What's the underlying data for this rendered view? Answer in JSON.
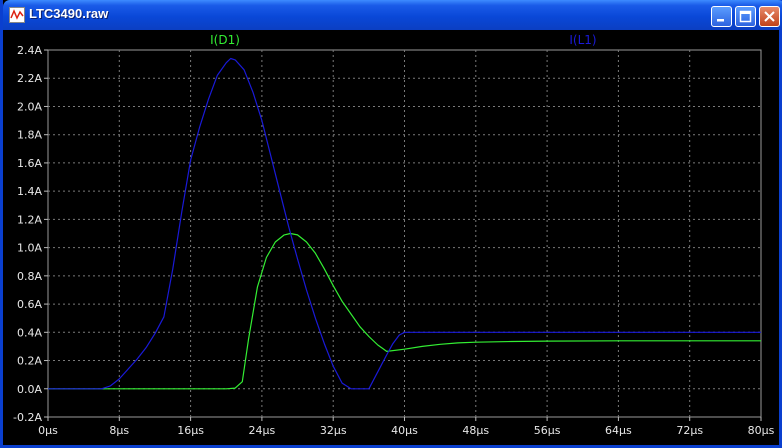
{
  "window": {
    "title": "LTC3490.raw",
    "buttons": {
      "minimize": "minimize-icon",
      "maximize": "maximize-icon",
      "close": "close-icon"
    }
  },
  "colors": {
    "plot_bg": "#000000",
    "grid": "#7a7a7a",
    "axis_text": "#e8e8e8",
    "series_D1": "#33ee33",
    "series_L1": "#1a1ad8"
  },
  "chart_data": {
    "type": "line",
    "title": "",
    "xlabel": "",
    "ylabel": "",
    "xlim": [
      0,
      80
    ],
    "ylim": [
      -0.2,
      2.4
    ],
    "grid": true,
    "legend": "top",
    "x_ticks": [
      "0µs",
      "8µs",
      "16µs",
      "24µs",
      "32µs",
      "40µs",
      "48µs",
      "56µs",
      "64µs",
      "72µs",
      "80µs"
    ],
    "y_ticks": [
      "2.4A",
      "2.2A",
      "2.0A",
      "1.8A",
      "1.6A",
      "1.4A",
      "1.2A",
      "1.0A",
      "0.8A",
      "0.6A",
      "0.4A",
      "0.2A",
      "0.0A",
      "-0.2A"
    ],
    "series": [
      {
        "name": "I(D1)",
        "color": "#33ee33",
        "x": [
          0,
          10,
          20,
          21,
          21.8,
          22.5,
          23.5,
          24.5,
          25.5,
          26.5,
          27.2,
          28,
          29,
          30,
          31,
          32,
          33,
          34,
          35,
          36,
          37,
          38,
          40,
          42,
          44,
          46,
          48,
          52,
          56,
          64,
          72,
          80
        ],
        "y": [
          0,
          0,
          0,
          0.005,
          0.05,
          0.35,
          0.72,
          0.93,
          1.04,
          1.09,
          1.1,
          1.09,
          1.04,
          0.96,
          0.85,
          0.73,
          0.62,
          0.53,
          0.44,
          0.37,
          0.31,
          0.265,
          0.28,
          0.3,
          0.315,
          0.325,
          0.33,
          0.335,
          0.338,
          0.34,
          0.34,
          0.34
        ]
      },
      {
        "name": "I(L1)",
        "color": "#1a1ad8",
        "x": [
          0,
          6,
          7,
          8,
          9,
          10,
          11,
          12,
          13,
          14,
          15,
          16,
          17,
          18,
          19,
          20,
          20.5,
          21,
          22,
          23,
          24,
          25,
          26,
          27,
          28,
          29,
          30,
          31,
          32,
          33,
          34,
          35,
          36,
          37,
          38,
          38.7,
          39.4,
          40,
          42,
          48,
          56,
          64,
          72,
          80
        ],
        "y": [
          0,
          0,
          0.02,
          0.07,
          0.14,
          0.21,
          0.29,
          0.39,
          0.51,
          0.85,
          1.25,
          1.62,
          1.85,
          2.05,
          2.22,
          2.31,
          2.34,
          2.33,
          2.26,
          2.1,
          1.9,
          1.65,
          1.4,
          1.15,
          0.92,
          0.7,
          0.5,
          0.32,
          0.16,
          0.04,
          0,
          0,
          0,
          0.12,
          0.24,
          0.32,
          0.38,
          0.4,
          0.4,
          0.4,
          0.4,
          0.4,
          0.4,
          0.4
        ]
      }
    ]
  }
}
